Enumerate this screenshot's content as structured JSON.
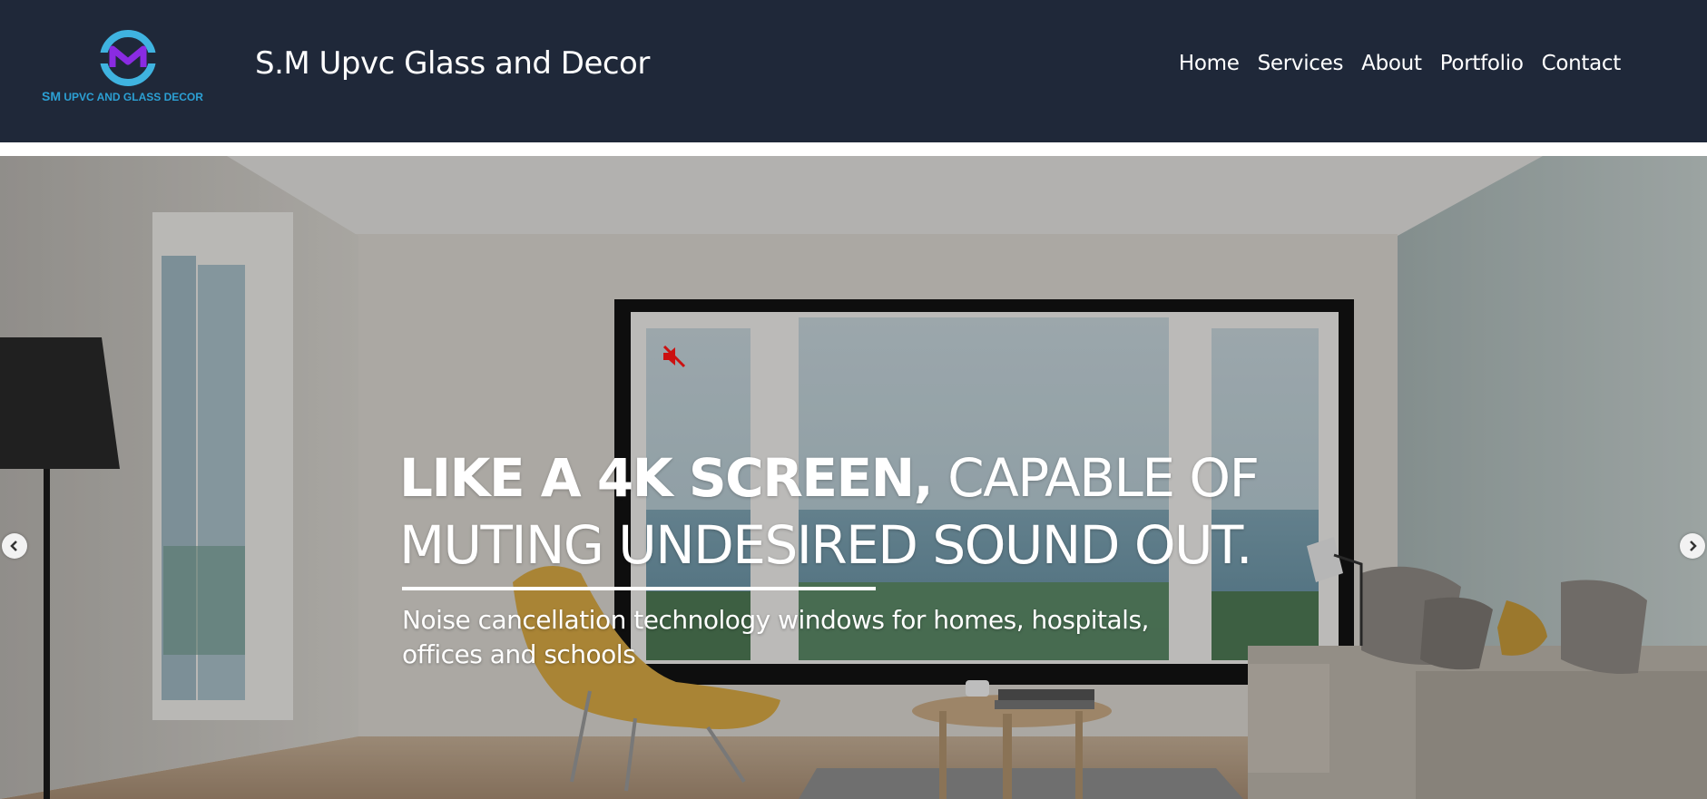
{
  "header": {
    "logo": {
      "initials": "SM",
      "subtitle": "UPVC AND GLASS DECOR"
    },
    "brand": "S.M Upvc Glass and Decor",
    "nav": [
      "Home",
      "Services",
      "About",
      "Portfolio",
      "Contact"
    ]
  },
  "hero": {
    "headline_bold": "LIKE A 4K SCREEN,",
    "headline_rest_1": " CAPABLE OF",
    "headline_line_2": "MUTING UNDESIRED SOUND OUT.",
    "subtext": "Noise cancellation technology windows for homes, hospitals, offices and schools",
    "icons": {
      "mute": "speaker-muted-icon",
      "prev": "chevron-left-icon",
      "next": "chevron-right-icon"
    }
  },
  "colors": {
    "header_bg": "#1f2839",
    "logo_accent": "#2ca0d4",
    "logo_purple": "#8a2be2",
    "mute_red": "#cc1111"
  }
}
